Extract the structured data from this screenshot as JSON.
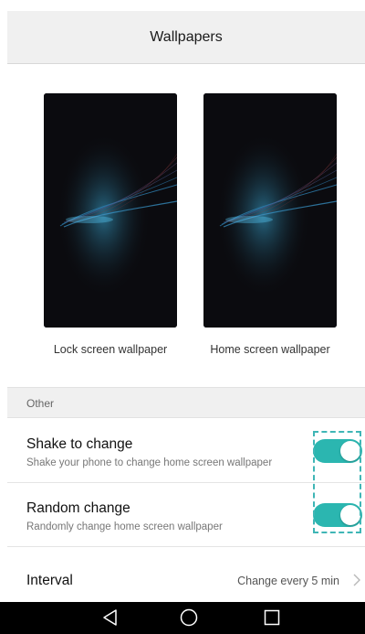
{
  "header": {
    "title": "Wallpapers"
  },
  "previews": {
    "lock_label": "Lock screen wallpaper",
    "home_label": "Home screen wallpaper"
  },
  "section": {
    "title": "Other"
  },
  "settings": {
    "shake": {
      "title": "Shake to change",
      "subtitle": "Shake your phone to change home screen wallpaper",
      "enabled": true
    },
    "random": {
      "title": "Random change",
      "subtitle": "Randomly change home screen wallpaper",
      "enabled": true
    },
    "interval": {
      "title": "Interval",
      "value": "Change every 5 min"
    }
  },
  "colors": {
    "accent": "#2bb6b0",
    "header_bg": "#f0f0f0",
    "nav_bg": "#000000"
  },
  "icons": {
    "back": "triangle-back-icon",
    "home": "circle-home-icon",
    "recent": "square-recent-icon",
    "chevron": "chevron-right-icon"
  }
}
